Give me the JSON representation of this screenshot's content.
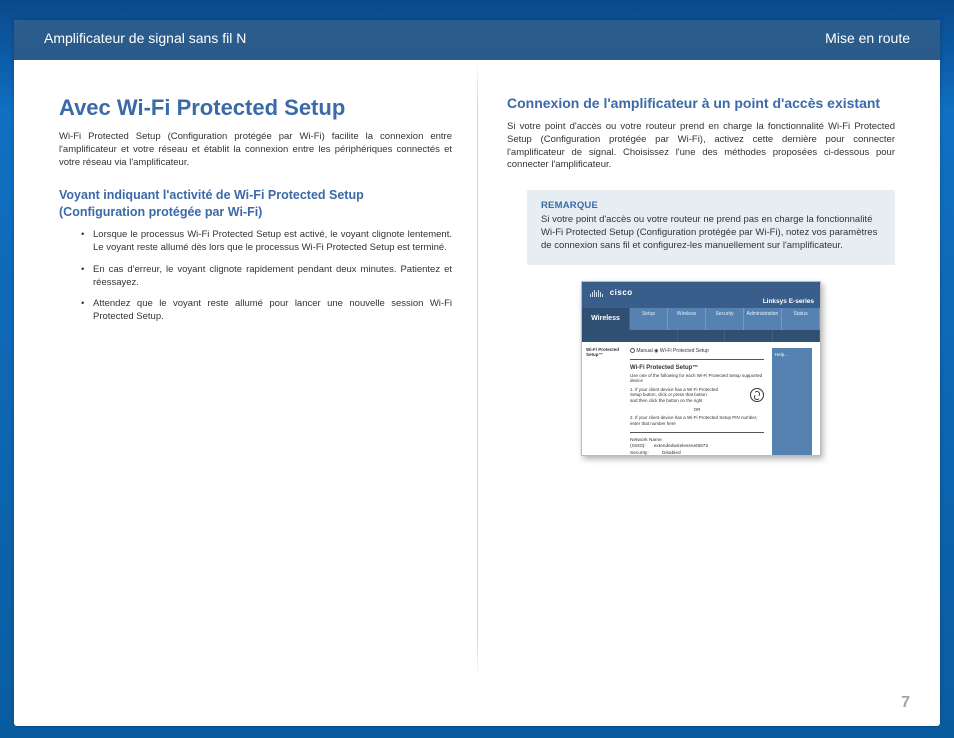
{
  "header": {
    "left": "Amplificateur de signal sans fil N",
    "right": "Mise en route"
  },
  "left_col": {
    "title": "Avec Wi-Fi Protected Setup",
    "intro": "Wi-Fi Protected Setup (Configuration protégée par Wi-Fi) facilite la connexion entre l'amplificateur et votre réseau et établit la connexion entre les périphériques connectés et votre réseau via l'amplificateur.",
    "section_heading_line1": "Voyant indiquant l'activité de Wi-Fi Protected Setup",
    "section_heading_line2": "(Configuration protégée par Wi-Fi)",
    "bullets": [
      "Lorsque le processus Wi-Fi Protected Setup est activé, le voyant clignote lentement. Le voyant reste allumé dès lors que le processus Wi-Fi Protected Setup est terminé.",
      "En cas d'erreur, le voyant clignote rapidement pendant deux minutes. Patientez et réessayez.",
      "Attendez que le voyant reste allumé pour lancer une nouvelle session Wi-Fi Protected Setup."
    ]
  },
  "right_col": {
    "heading": "Connexion de l'amplificateur à un point d'accès existant",
    "intro": "Si votre point d'accès ou votre routeur prend en charge la fonctionnalité Wi-Fi Protected Setup (Configuration protégée par Wi-Fi), activez cette dernière pour connecter l'amplificateur de signal. Choisissez l'une des méthodes proposées ci-dessous pour connecter l'amplificateur.",
    "note": {
      "label": "REMARQUE",
      "text": "Si votre point d'accès ou votre routeur ne prend pas en charge la fonctionnalité Wi-Fi Protected Setup (Configuration protégée par Wi-Fi), notez vos paramètres de connexion sans fil et configurez-les manuellement sur l'amplificateur."
    }
  },
  "figure": {
    "brand": "cisco",
    "product": "Linksys E-series",
    "nav_left": "Wireless",
    "tabs": [
      "Setup",
      "Wireless",
      "Security",
      "Administration",
      "Status"
    ],
    "sublabel": "Wi-Fi Protected Setup™",
    "manual_line": "Manual   ◉ Wi-Fi Protected Setup",
    "heading": "Wi-Fi Protected Setup™",
    "desc": "Use one of the following for each Wi-Fi Protected Setup supported device",
    "step1a": "1. If your client device has a Wi-Fi Protected",
    "step1b": "Setup button, click or press that button",
    "step1c": "and then click the button on the right",
    "or": "OR",
    "step2": "2. If your client device has a Wi-Fi Protected Setup PIN number, enter that number here",
    "net_name_label": "Network Name",
    "net_name_label2": "(SSID):",
    "net_name_value": "extendedwirelessnet5872",
    "sec_label": "Security:",
    "sec_value": "Disabled",
    "side": "Help..."
  },
  "page_number": "7"
}
